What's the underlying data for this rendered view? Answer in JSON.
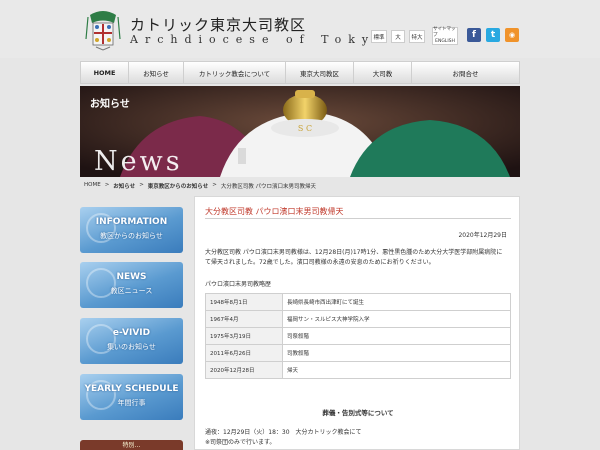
{
  "header": {
    "title": "カトリック東京大司教区",
    "subtitle": "Archdiocese of Tokyo",
    "font_sizes": [
      "標準",
      "大",
      "特大"
    ],
    "sitemap_ja": "サイトマップ",
    "sitemap_en": "ENGLISH",
    "social": [
      {
        "name": "facebook",
        "glyph": "f",
        "color": "#3b5998"
      },
      {
        "name": "twitter",
        "glyph": "t",
        "color": "#29a9e1"
      },
      {
        "name": "rss",
        "glyph": "◉",
        "color": "#f0932b"
      }
    ]
  },
  "nav": {
    "items": [
      {
        "label": "HOME"
      },
      {
        "label": "お知らせ"
      },
      {
        "label": "カトリック教会について"
      },
      {
        "label": "東京大司教区"
      },
      {
        "label": "大司教"
      },
      {
        "label": "お問合せ"
      }
    ]
  },
  "hero": {
    "label": "お知らせ",
    "word": "News",
    "cup_text": "S C"
  },
  "breadcrumb": [
    "HOME",
    ">",
    "お知らせ",
    ">",
    "東京教区からのお知らせ",
    ">",
    "大分教区司教 パウロ濱口末男司教帰天"
  ],
  "sidebar": [
    {
      "big": "INFORMATION",
      "small": "教区からのお知らせ"
    },
    {
      "big": "NEWS",
      "small": "教区ニュース"
    },
    {
      "big": "e-VIVID",
      "small": "集いのお知らせ"
    },
    {
      "big": "YEARLY SCHEDULE",
      "small": "年間行事"
    }
  ],
  "sidebar_partial": "特別…",
  "article": {
    "title": "大分教区司教 パウロ濱口末男司教帰天",
    "date": "2020年12月29日",
    "body": "大分教区司教 パウロ濱口末男司教様は、12月28日(月)17時1分、悪性黒色腫のため大分大学医学部附属病院にて帰天されました。72歳でした。濱口司教様の永遠の安息のためにお祈りください。",
    "profile_heading": "パウロ濱口末男司教略歴",
    "profile": [
      {
        "date": "1948年8月1日",
        "event": "長崎県長崎市西出津町にて誕生"
      },
      {
        "date": "1967年4月",
        "event": "福岡サン・スルピス大神学院入学"
      },
      {
        "date": "1975年3月19日",
        "event": "司祭叙階"
      },
      {
        "date": "2011年6月26日",
        "event": "司教叙階"
      },
      {
        "date": "2020年12月28日",
        "event": "帰天"
      }
    ],
    "funeral_heading": "葬儀・告別式等について",
    "funeral_line1": "通夜：12月29日（火）18：30　大分カトリック教会にて",
    "funeral_line2": "※司祭団のみで行います。"
  }
}
